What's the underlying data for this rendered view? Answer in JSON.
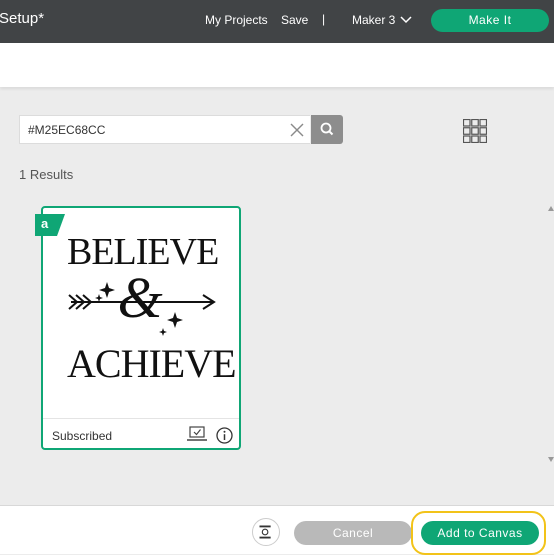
{
  "header": {
    "project_title": "Setup*",
    "my_projects": "My Projects",
    "save": "Save",
    "separator": "|",
    "machine": "Maker 3",
    "make_it": "Make It"
  },
  "search": {
    "value": "#M25EC68CC",
    "results_label": "1 Results"
  },
  "results": [
    {
      "art_top": "BELIEVE",
      "art_mid": "&",
      "art_bottom": "ACHIEVE",
      "badge": "a",
      "status": "Subscribed"
    }
  ],
  "footer": {
    "cancel": "Cancel",
    "add_to_canvas": "Add to Canvas"
  },
  "colors": {
    "brand_green": "#0fa675",
    "topbar": "#414446",
    "highlight": "#f2c319"
  },
  "icons": [
    "chevron-down-icon",
    "close-icon",
    "search-icon",
    "grid-view-icon",
    "access-badge-icon",
    "upload-icon",
    "info-icon"
  ]
}
